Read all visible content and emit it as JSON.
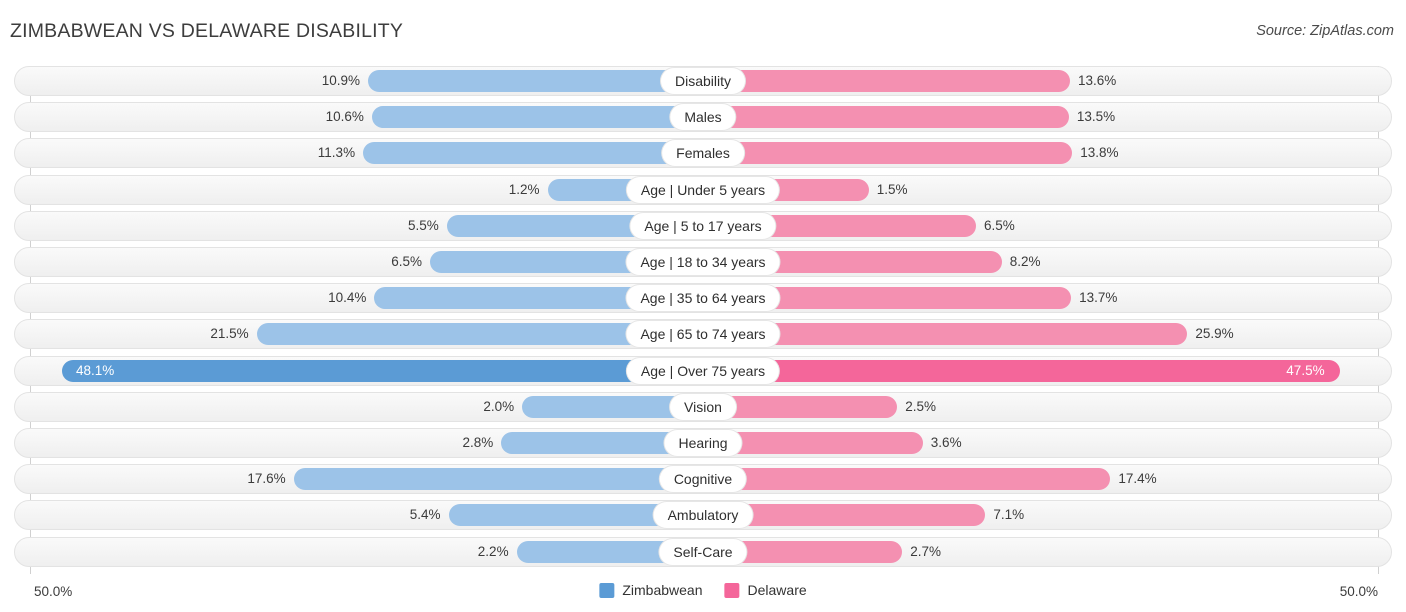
{
  "header": {
    "title": "ZIMBABWEAN VS DELAWARE DISABILITY",
    "source": "Source: ZipAtlas.com"
  },
  "footer": {
    "axis_left": "50.0%",
    "axis_right": "50.0%",
    "legend": [
      {
        "label": "Zimbabwean",
        "color": "#5B9BD5"
      },
      {
        "label": "Delaware",
        "color": "#F4669A"
      }
    ]
  },
  "colors": {
    "left_bar": "#9CC3E8",
    "right_bar": "#F490B1",
    "left_bar_highlight": "#5B9BD5",
    "right_bar_highlight": "#F4669A",
    "track": "#f4f4f4",
    "axis_line": "#d0d0d0"
  },
  "chart_data": {
    "type": "bar",
    "orientation": "horizontal-diverging",
    "title": "ZIMBABWEAN VS DELAWARE DISABILITY",
    "subtitle": "Source: ZipAtlas.com",
    "xlabel": "",
    "ylabel": "",
    "xlim": [
      50.0,
      50.0
    ],
    "axis_tick_labels": [
      "50.0%",
      "50.0%"
    ],
    "grid": false,
    "legend_position": "bottom-center",
    "categories": [
      "Disability",
      "Males",
      "Females",
      "Age | Under 5 years",
      "Age | 5 to 17 years",
      "Age | 18 to 34 years",
      "Age | 35 to 64 years",
      "Age | 65 to 74 years",
      "Age | Over 75 years",
      "Vision",
      "Hearing",
      "Cognitive",
      "Ambulatory",
      "Self-Care"
    ],
    "series": [
      {
        "name": "Zimbabwean",
        "side": "left",
        "color": "#9CC3E8",
        "values": [
          10.9,
          10.6,
          11.3,
          1.2,
          5.5,
          6.5,
          10.4,
          21.5,
          48.1,
          2.0,
          2.8,
          17.6,
          5.4,
          2.2
        ],
        "labels": [
          "10.9%",
          "10.6%",
          "11.3%",
          "1.2%",
          "5.5%",
          "6.5%",
          "10.4%",
          "21.5%",
          "48.1%",
          "2.0%",
          "2.8%",
          "17.6%",
          "5.4%",
          "2.2%"
        ]
      },
      {
        "name": "Delaware",
        "side": "right",
        "color": "#F490B1",
        "values": [
          13.6,
          13.5,
          13.8,
          1.5,
          6.5,
          8.2,
          13.7,
          25.9,
          47.5,
          2.5,
          3.6,
          17.4,
          7.1,
          2.7
        ],
        "labels": [
          "13.6%",
          "13.5%",
          "13.8%",
          "1.5%",
          "6.5%",
          "8.2%",
          "13.7%",
          "25.9%",
          "47.5%",
          "2.5%",
          "3.6%",
          "17.4%",
          "7.1%",
          "2.7%"
        ]
      }
    ],
    "highlighted_rows": [
      "Age | Over 75 years"
    ]
  }
}
